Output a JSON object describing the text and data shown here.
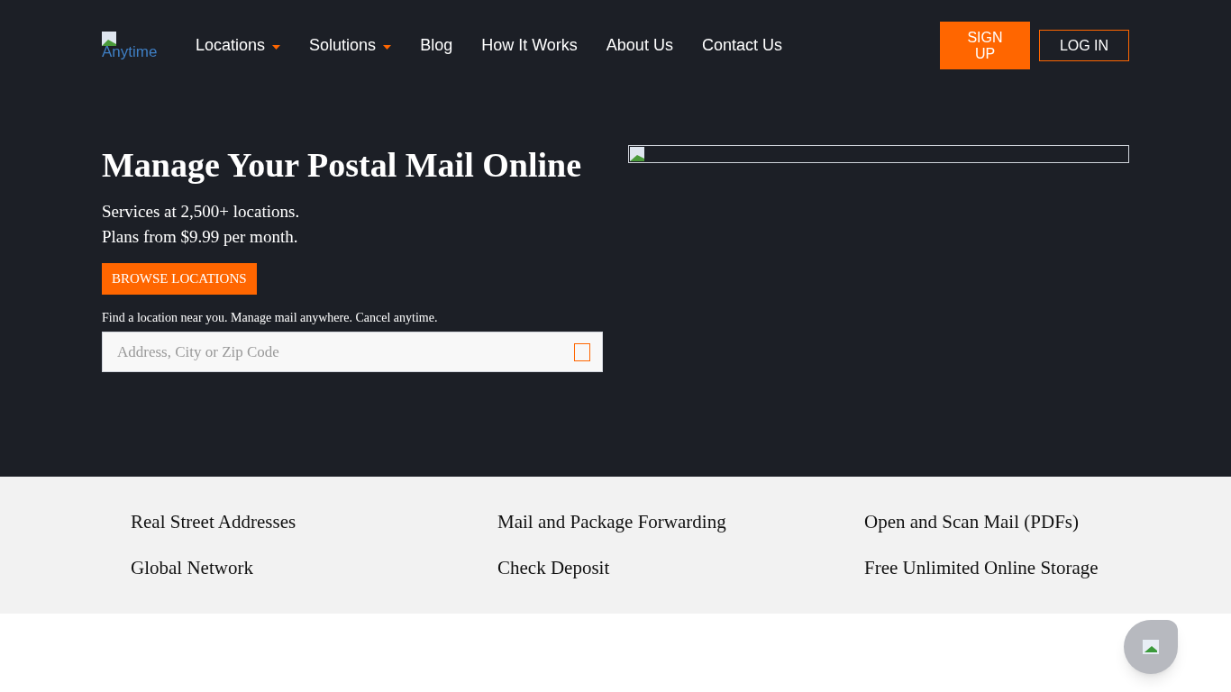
{
  "header": {
    "logo_text": "Anytime",
    "nav": [
      {
        "label": "Locations",
        "dropdown": true
      },
      {
        "label": "Solutions",
        "dropdown": true
      },
      {
        "label": "Blog",
        "dropdown": false
      },
      {
        "label": "How It Works",
        "dropdown": false
      },
      {
        "label": "About Us",
        "dropdown": false
      },
      {
        "label": "Contact Us",
        "dropdown": false
      }
    ],
    "buttons": [
      {
        "label": "SIGN UP",
        "kind": "filled"
      },
      {
        "label": "LOG IN",
        "kind": "outline"
      }
    ]
  },
  "hero": {
    "title": "Manage Your Postal Mail Online",
    "lines": [
      "Services at 2,500+ locations.",
      "Plans from $9.99 per month."
    ],
    "cta": "BROWSE LOCATIONS",
    "hint": "Find a location near you. Manage mail anywhere. Cancel anytime.",
    "search": {
      "placeholder": "Address, City or Zip Code"
    }
  },
  "features": [
    "Real Street Addresses",
    "Mail and Package Forwarding",
    "Open and Scan Mail (PDFs)",
    "Global Network",
    "Check Deposit",
    "Free Unlimited Online Storage"
  ]
}
